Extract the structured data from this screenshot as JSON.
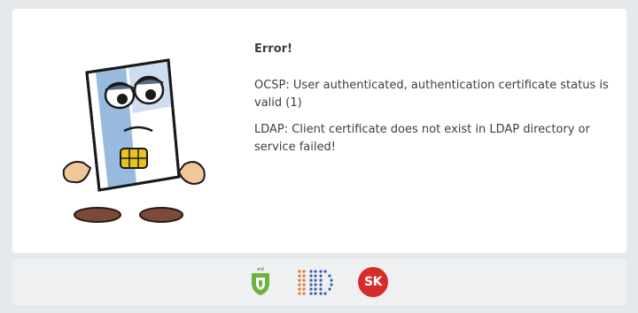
{
  "error": {
    "title": "Error!",
    "ocsp_message": "OCSP: User authenticated, authentication certificate status is valid (1)",
    "ldap_message": "LDAP: Client certificate does not exist in LDAP directory or service failed!"
  },
  "illustration": {
    "icon": "sad-id-card-mascot"
  },
  "footer": {
    "logos": [
      {
        "icon": "shield-logo",
        "caption": "eid",
        "color": "#6db33f"
      },
      {
        "icon": "dotted-id-logo",
        "color_left": "#e8742c",
        "color_right": "#3b5fa8"
      },
      {
        "icon": "sk-logo",
        "text": "SK",
        "color": "#d52b2b"
      }
    ]
  }
}
